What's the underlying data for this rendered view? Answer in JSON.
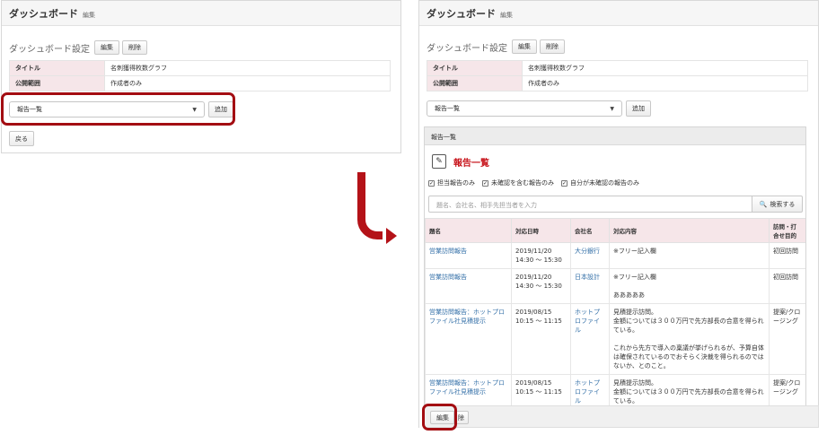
{
  "left": {
    "header": {
      "title": "ダッシュボード",
      "edit_link": "編集"
    },
    "settings": {
      "label": "ダッシュボード設定",
      "edit_btn": "編集",
      "delete_btn": "削除"
    },
    "info": [
      {
        "key": "タイトル",
        "value": "名刺獲得枚数グラフ"
      },
      {
        "key": "公開範囲",
        "value": "作成者のみ"
      }
    ],
    "select": {
      "value": "報告一覧",
      "add_btn": "追加"
    },
    "back_btn": "戻る"
  },
  "right": {
    "header": {
      "title": "ダッシュボード",
      "edit_link": "編集"
    },
    "settings": {
      "label": "ダッシュボード設定",
      "edit_btn": "編集",
      "delete_btn": "削除"
    },
    "info": [
      {
        "key": "タイトル",
        "value": "名刺獲得枚数グラフ"
      },
      {
        "key": "公開範囲",
        "value": "作成者のみ"
      }
    ],
    "select": {
      "value": "報告一覧",
      "add_btn": "追加"
    },
    "list": {
      "panel_title": "報告一覧",
      "report_title": "報告一覧",
      "filters": [
        {
          "label": "担当報告のみ",
          "checked": true
        },
        {
          "label": "未確認を含む報告のみ",
          "checked": true
        },
        {
          "label": "自分が未確認の報告のみ",
          "checked": true
        }
      ],
      "search_placeholder": "題名、会社名、相手先担当者を入力",
      "search_btn": "検索する",
      "columns": [
        "題名",
        "対応日時",
        "会社名",
        "対応内容",
        "訪問・打合せ目的"
      ],
      "rows": [
        {
          "title": "営業訪問報告",
          "datetime": "2019/11/20 14:30 ～ 15:30",
          "company": "大分銀行",
          "content": "※フリー記入欄",
          "purpose": "初回訪問"
        },
        {
          "title": "営業訪問報告",
          "datetime": "2019/11/20 14:30 ～ 15:30",
          "company": "日本設計",
          "content": "※フリー記入欄\n\nあああああ",
          "purpose": "初回訪問"
        },
        {
          "title": "営業訪問報告：ホットプロファイル社見積提示",
          "datetime": "2019/08/15 10:15 ～ 11:15",
          "company": "ホットプロファイル",
          "content": "見積提示訪問。\n金額については３００万円で先方部長の合意を得られている。\n\nこれから先方で導入の稟議が挙げられるが、予算自体は確保されているのでおそらく決裁を得られるのではないか、とのこと。",
          "purpose": "提案/クロージング"
        },
        {
          "title": "営業訪問報告：ホットプロファイル社見積提示",
          "datetime": "2019/08/15 10:15 ～ 11:15",
          "company": "ホットプロファイル",
          "content": "見積提示訪問。\n金額については３００万円で先方部長の合意を得られている。",
          "purpose": "提案/クロージング"
        }
      ]
    },
    "bottom": {
      "edit_btn": "編集",
      "delete_btn_partial": "除"
    }
  },
  "colors": {
    "highlight": "#a30d12",
    "accent_red": "#c8161d",
    "header_pink": "#f6e6e9",
    "link_blue": "#3470a8"
  }
}
